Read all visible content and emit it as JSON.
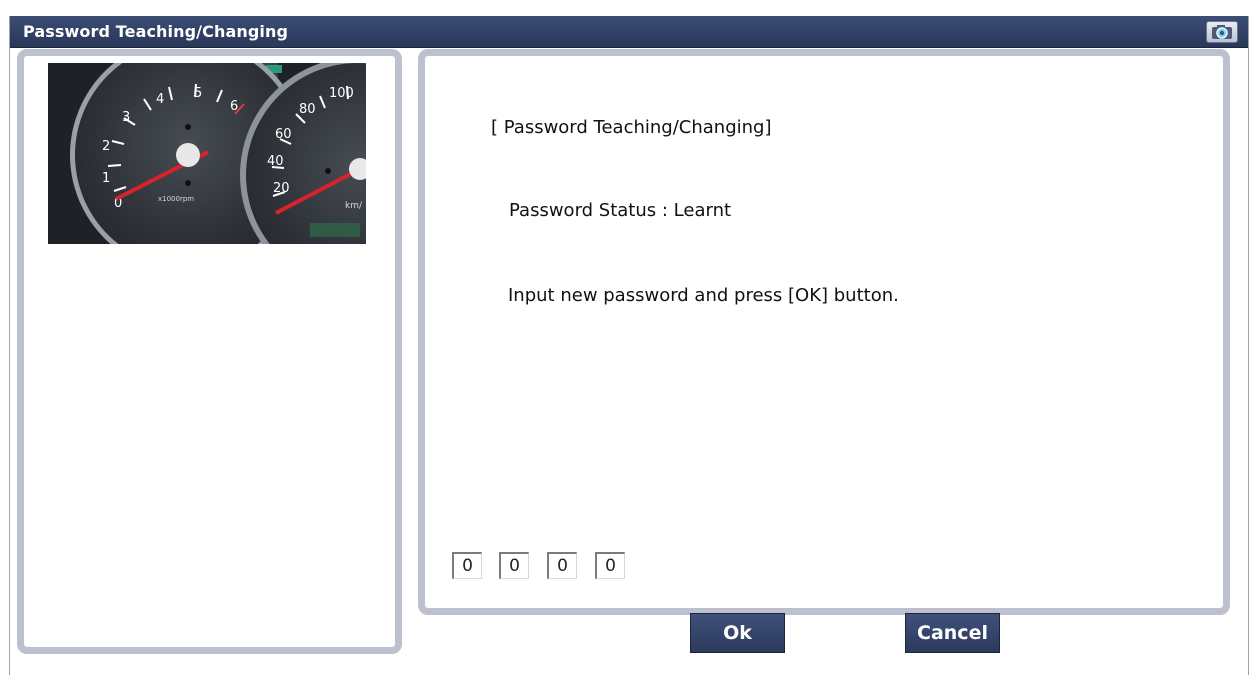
{
  "window": {
    "title": "Password Teaching/Changing",
    "camera_icon": "camera-icon"
  },
  "gauge_image": {
    "tach_numbers": [
      "0",
      "1",
      "2",
      "3",
      "4",
      "5",
      "6"
    ],
    "tach_unit": "x1000rpm",
    "speedo_numbers": [
      "20",
      "40",
      "60",
      "80",
      "100"
    ],
    "speedo_unit": "km/"
  },
  "content": {
    "heading": "[ Password Teaching/Changing]",
    "status": "Password Status : Learnt",
    "instruction": "Input new password and press [OK] button."
  },
  "password_digits": [
    "0",
    "0",
    "0",
    "0"
  ],
  "buttons": {
    "ok": "Ok",
    "cancel": "Cancel"
  },
  "colors": {
    "titlebar": "#2f3f63",
    "panel_border": "#bcc0cf",
    "button_bg": "#33426a",
    "needle": "#d9232a"
  }
}
